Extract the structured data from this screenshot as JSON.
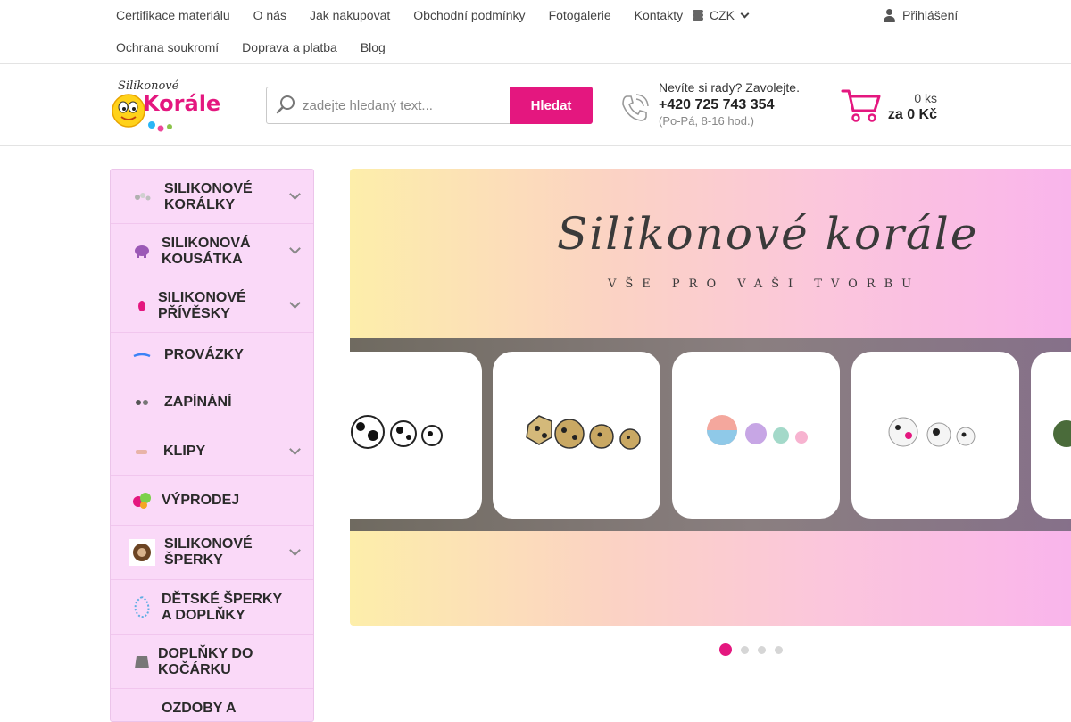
{
  "topnav": {
    "row1": [
      "Certifikace materiálu",
      "O nás",
      "Jak nakupovat",
      "Obchodní podmínky",
      "Fotogalerie",
      "Kontakty"
    ],
    "row2": [
      "Ochrana soukromí",
      "Doprava a platba",
      "Blog"
    ],
    "currency": "CZK",
    "login": "Přihlášení"
  },
  "logo": {
    "top_word": "Silikonové",
    "main_word": "Korále"
  },
  "search": {
    "placeholder": "zadejte hledaný text...",
    "button": "Hledat"
  },
  "contact": {
    "question": "Nevíte si rady? Zavolejte.",
    "phone": "+420 725 743 354",
    "hours": "(Po-Pá, 8-16 hod.)"
  },
  "cart": {
    "qty": "0 ks",
    "price": "za 0 Kč"
  },
  "sidebar": {
    "items": [
      {
        "label1": "SILIKONOVÉ",
        "label2": "KORÁLKY",
        "icon": "beads-icon",
        "expandable": true
      },
      {
        "label1": "SILIKONOVÁ",
        "label2": "KOUSÁTKA",
        "icon": "elephant-teether-icon",
        "expandable": true
      },
      {
        "label1": "SILIKONOVÉ",
        "label2": "PŘÍVĚSKY",
        "icon": "pendant-icon",
        "expandable": true
      },
      {
        "label1": "PROVÁZKY",
        "label2": "",
        "icon": "cord-icon",
        "expandable": false
      },
      {
        "label1": "ZAPÍNÁNÍ",
        "label2": "",
        "icon": "clasp-icon",
        "expandable": false
      },
      {
        "label1": "KLIPY",
        "label2": "",
        "icon": "clip-icon",
        "expandable": true
      },
      {
        "label1": "VÝPRODEJ",
        "label2": "",
        "icon": "sale-icon",
        "expandable": false
      },
      {
        "label1": "SILIKONOVÉ",
        "label2": "ŠPERKY",
        "icon": "jewelry-icon",
        "expandable": true
      },
      {
        "label1": "DĚTSKÉ ŠPERKY",
        "label2": "A DOPLŇKY",
        "icon": "kids-jewelry-icon",
        "expandable": false
      },
      {
        "label1": "DOPLŇKY DO",
        "label2": "KOČÁRKU",
        "icon": "stroller-accessory-icon",
        "expandable": false
      },
      {
        "label1": "OZDOBY A",
        "label2": "",
        "icon": "decoration-icon",
        "expandable": false
      }
    ]
  },
  "banner": {
    "title": "Silikonové korále",
    "subtitle": "VŠE PRO VAŠI TVORBU",
    "slide_count": 4,
    "active_slide": 1
  },
  "colors": {
    "accent": "#e4177f",
    "sidebar_bg": "#fad9f8"
  }
}
